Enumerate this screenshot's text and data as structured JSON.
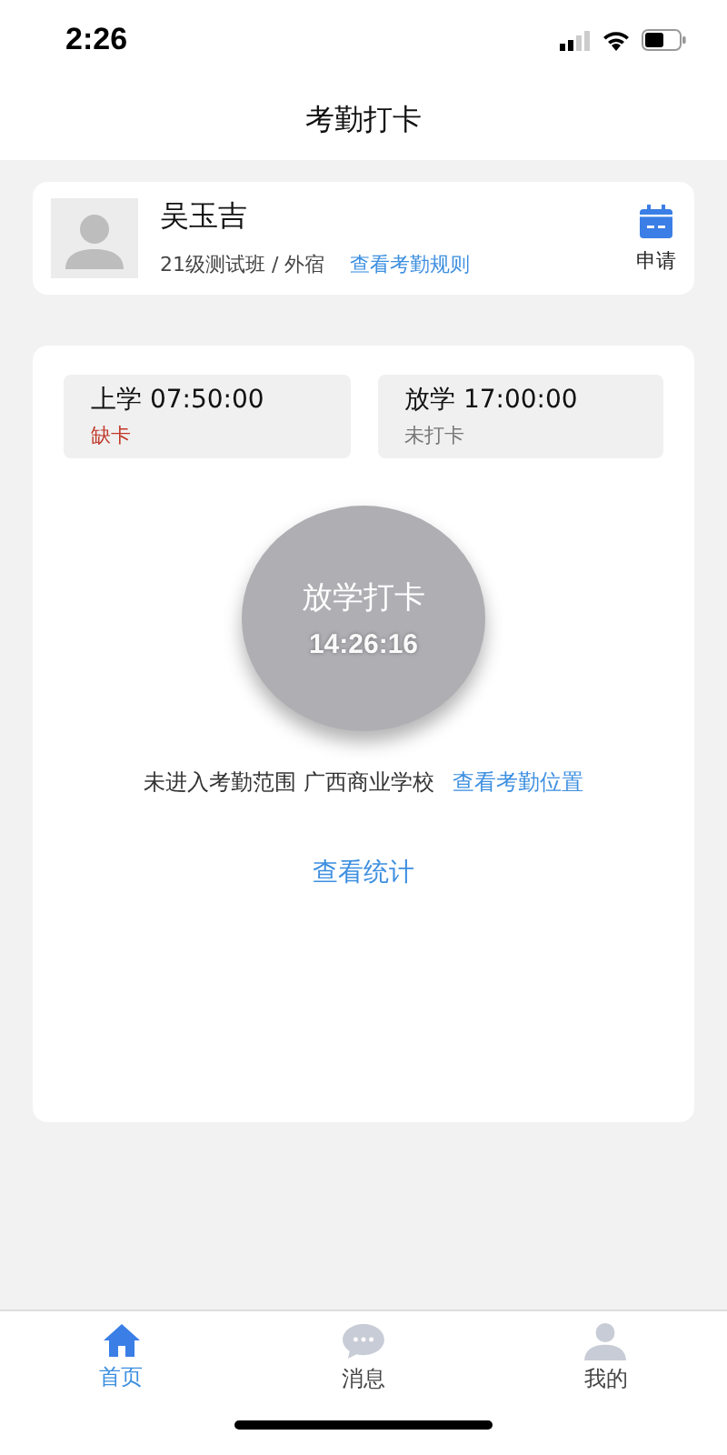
{
  "status_bar": {
    "time": "2:26"
  },
  "header": {
    "title": "考勤打卡"
  },
  "profile": {
    "name": "吴玉吉",
    "class_info": "21级测试班 / 外宿",
    "rules_link": "查看考勤规则",
    "apply_label": "申请"
  },
  "slots": [
    {
      "label": "上学 07:50:00",
      "status": "缺卡",
      "missed": true
    },
    {
      "label": "放学 17:00:00",
      "status": "未打卡",
      "missed": false
    }
  ],
  "punch_button": {
    "label": "放学打卡",
    "time": "14:26:16",
    "disabled": true
  },
  "location": {
    "message": "未进入考勤范围 广西商业学校",
    "link": "查看考勤位置"
  },
  "stats_link": "查看统计",
  "tab_bar": [
    {
      "label": "首页",
      "kind": "home",
      "selected": true
    },
    {
      "label": "消息",
      "kind": "message",
      "selected": false
    },
    {
      "label": "我的",
      "kind": "profile",
      "selected": false
    }
  ]
}
